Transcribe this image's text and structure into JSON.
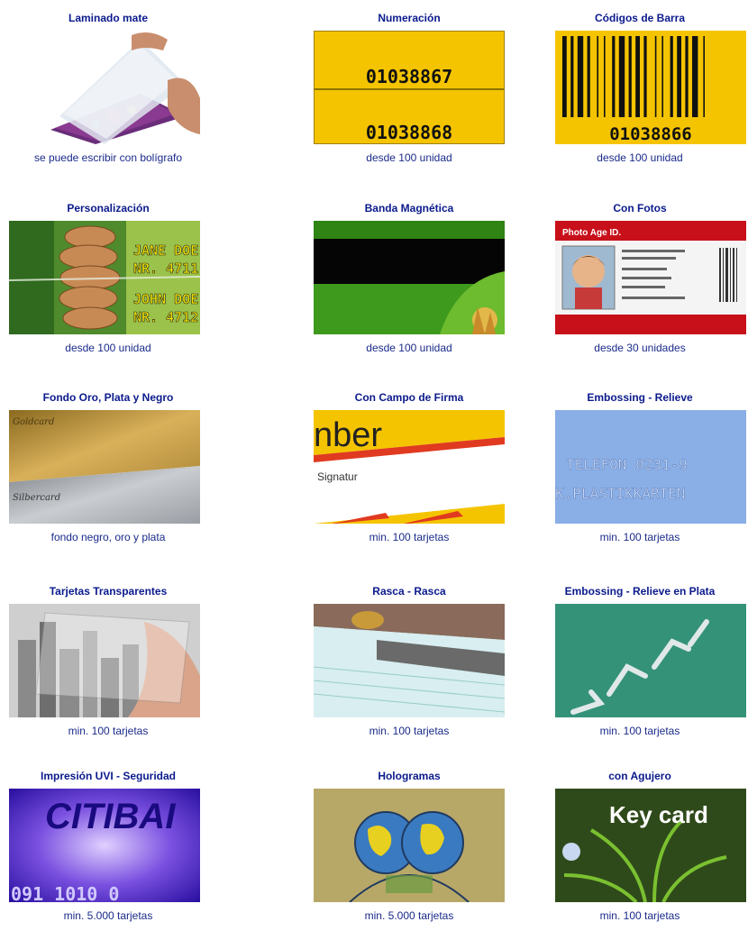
{
  "products": [
    {
      "title": "Laminado mate",
      "caption": "se puede escribir con bolígrafo"
    },
    {
      "title": "Numeración",
      "caption": "desde 100 unidad",
      "numbers": [
        "01038867",
        "01038868"
      ]
    },
    {
      "title": "Códigos de Barra",
      "caption": "desde 100 unidad",
      "number": "01038866"
    },
    {
      "title": "Personalización",
      "caption": "desde 100 unidad",
      "text1": "JANE DOE",
      "text2": "NR. 4711",
      "text3": "JOHN DOE",
      "text4": "NR. 4712"
    },
    {
      "title": "Banda Magnética",
      "caption": "desde 100 unidad"
    },
    {
      "title": "Con Fotos",
      "caption": "desde 30 unidades",
      "header": "Photo Age ID."
    },
    {
      "title": "Fondo Oro, Plata y Negro",
      "caption": "fondo negro, oro y plata",
      "gold": "Goldcard",
      "silver": "Silbercard"
    },
    {
      "title": "Con Campo de Firma",
      "caption": "min. 100 tarjetas",
      "big": "nber",
      "sig": "Signatur"
    },
    {
      "title": "Embossing - Relieve",
      "caption": "min. 100 tarjetas",
      "line1": "TELEFON 0231-9",
      "line2": "K.PLASTIKKARTEN"
    },
    {
      "title": "Tarjetas Transparentes",
      "caption": "min. 100 tarjetas"
    },
    {
      "title": "Rasca - Rasca",
      "caption": "min. 100 tarjetas"
    },
    {
      "title": "Embossing - Relieve en Plata",
      "caption": "min. 100 tarjetas"
    },
    {
      "title": "Impresión UVI - Seguridad",
      "caption": "min. 5.000 tarjetas",
      "text": "CITIBAI",
      "code": "091  1010  0"
    },
    {
      "title": "Hologramas",
      "caption": "min. 5.000 tarjetas"
    },
    {
      "title": "con Agujero",
      "caption": "min. 100 tarjetas",
      "text": "Key card"
    }
  ]
}
